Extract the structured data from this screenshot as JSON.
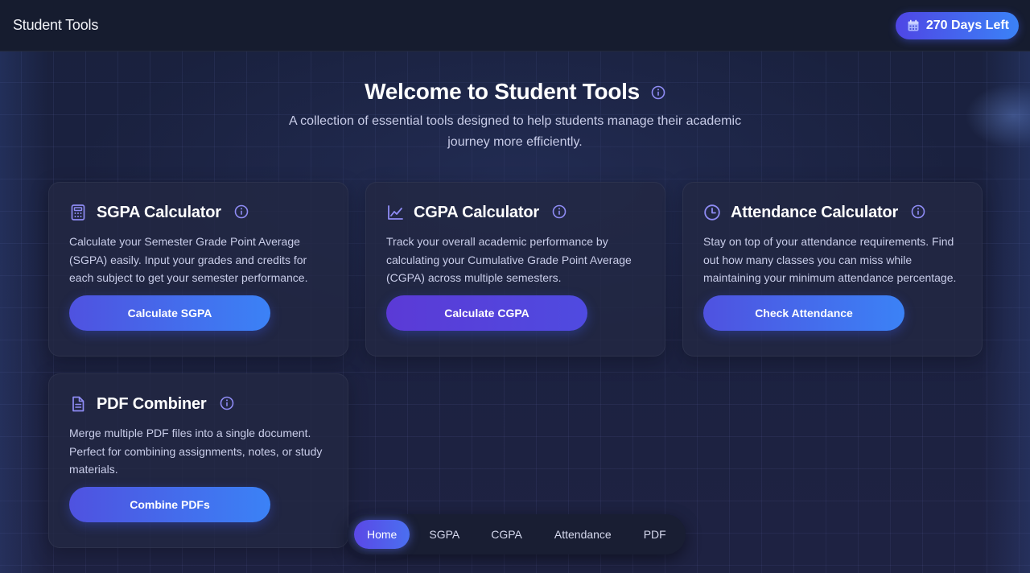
{
  "header": {
    "brand": "Student Tools",
    "badge": {
      "label": "270 Days Left",
      "icon": "calendar-icon"
    }
  },
  "hero": {
    "title": "Welcome to Student Tools",
    "subtitle": "A collection of essential tools designed to help students manage their academic journey more efficiently."
  },
  "tools": [
    {
      "icon": "calculator-icon",
      "title": "SGPA Calculator",
      "description": "Calculate your Semester Grade Point Average (SGPA) easily. Input your grades and credits for each subject to get your semester performance.",
      "button": "Calculate SGPA"
    },
    {
      "icon": "chart-line-icon",
      "title": "CGPA Calculator",
      "description": "Track your overall academic performance by calculating your Cumulative Grade Point Average (CGPA) across multiple semesters.",
      "button": "Calculate CGPA"
    },
    {
      "icon": "clock-icon",
      "title": "Attendance Calculator",
      "description": "Stay on top of your attendance requirements. Find out how many classes you can miss while maintaining your minimum attendance percentage.",
      "button": "Check Attendance"
    },
    {
      "icon": "document-icon",
      "title": "PDF Combiner",
      "description": "Merge multiple PDF files into a single document. Perfect for combining assignments, notes, or study materials.",
      "button": "Combine PDFs"
    }
  ],
  "nav": {
    "items": [
      "Home",
      "SGPA",
      "CGPA",
      "Attendance",
      "PDF"
    ],
    "active": "Home"
  },
  "colors": {
    "accent": "#4f52e0",
    "accent_end": "#3b82f6",
    "icon": "#8f8cf5",
    "background": "#1c2444"
  }
}
